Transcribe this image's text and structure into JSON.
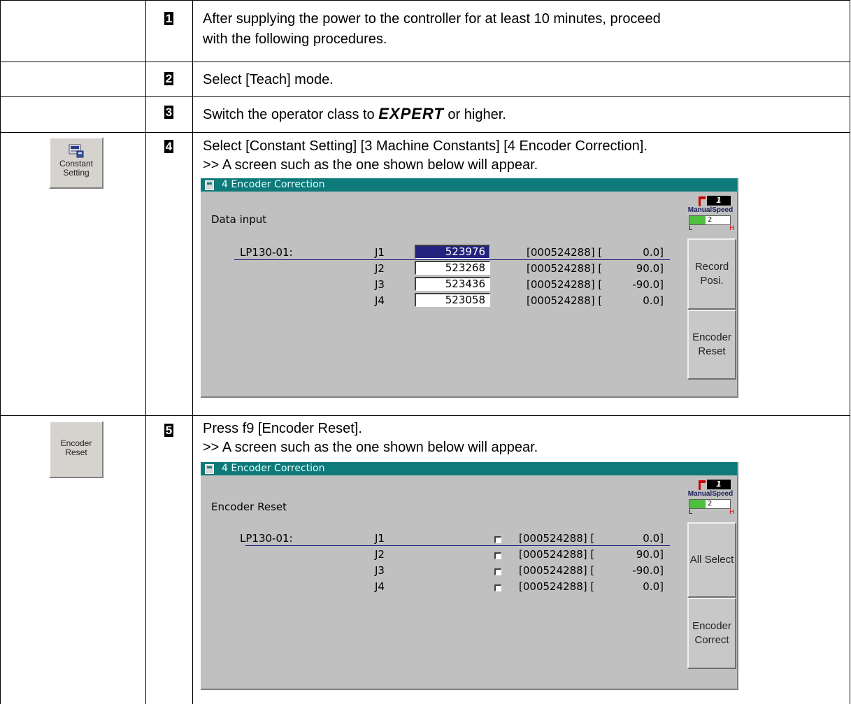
{
  "steps": [
    {
      "num": "1",
      "line1": "After supplying the power to the controller for at least 10 minutes, proceed",
      "line2": "with the following procedures."
    },
    {
      "num": "2",
      "line1": "Select [Teach] mode."
    },
    {
      "num": "3",
      "pre": "Switch the operator class to ",
      "emphasis": "EXPERT",
      "post": " or higher."
    },
    {
      "num": "4",
      "line1": "Select [Constant Setting] [3 Machine Constants] [4 Encoder Correction].",
      "line2": ">> A screen such as the one shown below will appear."
    },
    {
      "num": "5",
      "line1": "Press f9 [Encoder Reset].",
      "line2": ">> A screen such as the one shown below will appear."
    }
  ],
  "side_buttons": {
    "constant_setting": {
      "line1": "Constant",
      "line2": "Setting"
    },
    "encoder_reset": {
      "line1": "Encoder",
      "line2": "Reset"
    }
  },
  "screen1": {
    "title": "4 Encoder Correction",
    "heading": "Data input",
    "robot": "LP130-01:",
    "rows": [
      {
        "axis": "J1",
        "value": "523976",
        "ref": "[000524288] [",
        "angle": "0.0]"
      },
      {
        "axis": "J2",
        "value": "523268",
        "ref": "[000524288] [",
        "angle": "90.0]"
      },
      {
        "axis": "J3",
        "value": "523436",
        "ref": "[000524288] [",
        "angle": "-90.0]"
      },
      {
        "axis": "J4",
        "value": "523058",
        "ref": "[000524288] [",
        "angle": "0.0]"
      }
    ],
    "status": {
      "mode": "1",
      "label": "ManualSpeed",
      "speed": "2",
      "low": "L",
      "high": "H"
    },
    "buttons": [
      {
        "line1": "Record",
        "line2": "Posi."
      },
      {
        "line1": "Encoder",
        "line2": "Reset"
      }
    ]
  },
  "screen2": {
    "title": "4 Encoder Correction",
    "heading": "Encoder Reset",
    "robot": "LP130-01:",
    "rows": [
      {
        "axis": "J1",
        "ref": "[000524288] [",
        "angle": "0.0]"
      },
      {
        "axis": "J2",
        "ref": "[000524288] [",
        "angle": "90.0]"
      },
      {
        "axis": "J3",
        "ref": "[000524288] [",
        "angle": "-90.0]"
      },
      {
        "axis": "J4",
        "ref": "[000524288] [",
        "angle": "0.0]"
      }
    ],
    "status": {
      "mode": "1",
      "label": "ManualSpeed",
      "speed": "2",
      "low": "L",
      "high": "H"
    },
    "buttons": [
      {
        "line1": "All Select"
      },
      {
        "line1": "Encoder",
        "line2": "Correct"
      }
    ]
  },
  "speed_fill_fraction": 0.4,
  "colors": {
    "titlebar": "#0f7a7a",
    "screen_bg": "#c0c0c0",
    "active_field": "#23237e",
    "speed_fill": "#4fbf3f"
  }
}
